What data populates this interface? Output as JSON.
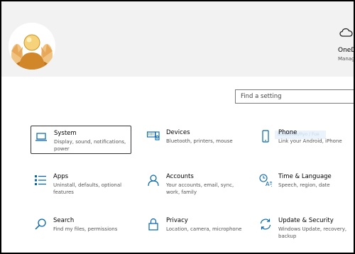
{
  "header": {
    "onedrive_title": "OneD",
    "onedrive_sub": "Manag"
  },
  "search": {
    "placeholder": "Find a setting"
  },
  "tiles": [
    {
      "title": "System",
      "desc": "Display, sound, notifications, power",
      "icon": "laptop-icon"
    },
    {
      "title": "Devices",
      "desc": "Bluetooth, printers, mouse",
      "icon": "keyboard-speaker-icon"
    },
    {
      "title": "Phone",
      "desc": "Link your Android, iPhone",
      "icon": "phone-icon"
    },
    {
      "title": "Apps",
      "desc": "Uninstall, defaults, optional features",
      "icon": "apps-list-icon"
    },
    {
      "title": "Accounts",
      "desc": "Your accounts, email, sync, work, family",
      "icon": "person-icon"
    },
    {
      "title": "Time & Language",
      "desc": "Speech, region, date",
      "icon": "time-language-icon"
    },
    {
      "title": "Search",
      "desc": "Find my files, permissions",
      "icon": "search-icon"
    },
    {
      "title": "Privacy",
      "desc": "Location, camera, microphone",
      "icon": "lock-icon"
    },
    {
      "title": "Update & Security",
      "desc": "Windows Update, recovery, backup",
      "icon": "sync-icon"
    }
  ],
  "ghost_tooltip": "Bluetooth/Ryo / Fue",
  "colors": {
    "accent": "#0063b1",
    "header_bg": "#f2f2f2"
  }
}
